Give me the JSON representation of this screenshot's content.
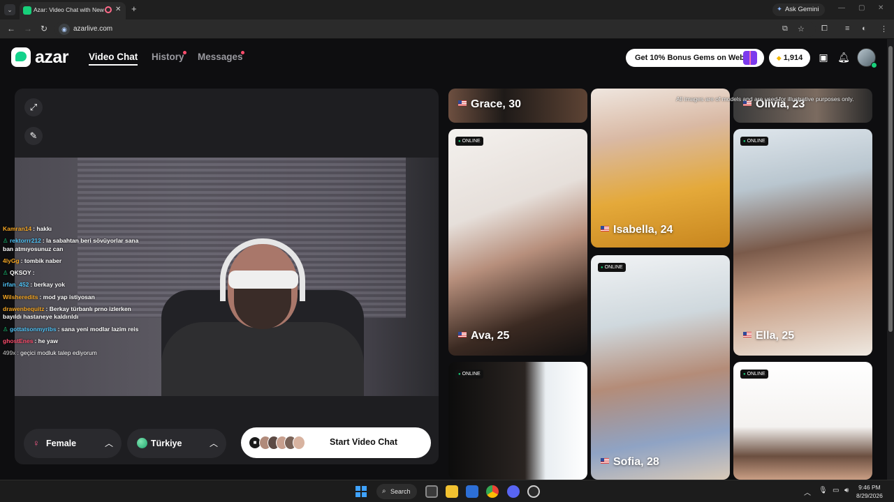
{
  "browser": {
    "tab_title": "Azar: Video Chat with New",
    "new_tab_symbol": "+",
    "ask_gemini": "Ask Gemini",
    "url": "azarlive.com"
  },
  "header": {
    "logo_text": "azar",
    "nav": [
      {
        "label": "Video Chat"
      },
      {
        "label": "History"
      },
      {
        "label": "Messages"
      }
    ],
    "promo_label": "Get 10% Bonus Gems on Web!",
    "gems_count": "1,914"
  },
  "video": {
    "chat": [
      {
        "user": "Kamran14",
        "user_color": "#f5a623",
        "msg": "hakkı",
        "icon": false
      },
      {
        "user": "rektorrr212",
        "user_color": "#4fc3f7",
        "msg": "la sabahtan beri sövüyorlar sana ban atmıyosunuz can",
        "icon": true
      },
      {
        "user": "4lyGg",
        "user_color": "#f5a623",
        "msg": "tombik naber",
        "icon": false
      },
      {
        "user": "QKSOY",
        "user_color": "#ffffff",
        "msg": "",
        "icon": true
      },
      {
        "user": "irfan_452",
        "user_color": "#4fc3f7",
        "msg": "berkay yok",
        "icon": false
      },
      {
        "user": "Wilsheredits",
        "user_color": "#f5a623",
        "msg": "mod yap istiyosan",
        "icon": false
      },
      {
        "user": "drawenbequitz",
        "user_color": "#f5a623",
        "msg": "Berkay türbanlı prno izlerken bayıldı hastaneye kaldırıldı",
        "icon": false
      },
      {
        "user": "gottatsonmyribs",
        "user_color": "#4fc3f7",
        "msg": "sana yeni modlar lazim reis",
        "icon": true
      },
      {
        "user": "ghostEnes",
        "user_color": "#ff4d6d",
        "msg": "he yaw",
        "icon": false
      },
      {
        "user": "499x",
        "user_color": "#cfcfcf",
        "msg": "geçici modluk talep ediyorum",
        "icon": false
      }
    ],
    "gender_label": "Female",
    "country_label": "Türkiye",
    "start_label": "Start Video Chat"
  },
  "grid": {
    "disclaimer": "All images are of models and are used for illustrative purposes only.",
    "online_label": "ONLINE",
    "cards": [
      {
        "name": "Grace, 30",
        "online": false
      },
      {
        "name": "Isabella, 24",
        "online": false
      },
      {
        "name": "Olivia, 23",
        "online": false
      },
      {
        "name": "Ava, 25",
        "online": true
      },
      {
        "name": "Ella, 25",
        "online": true
      },
      {
        "name": "Sofia, 28",
        "online": true
      },
      {
        "name": "",
        "online": true
      },
      {
        "name": "",
        "online": true
      }
    ]
  },
  "taskbar": {
    "search_label": "Search",
    "time": "9:46 PM",
    "date": "8/29/2026"
  },
  "colors": {
    "brand_green": "#12d28b",
    "online_green": "#17d07a",
    "notify_red": "#ff4d6d"
  }
}
